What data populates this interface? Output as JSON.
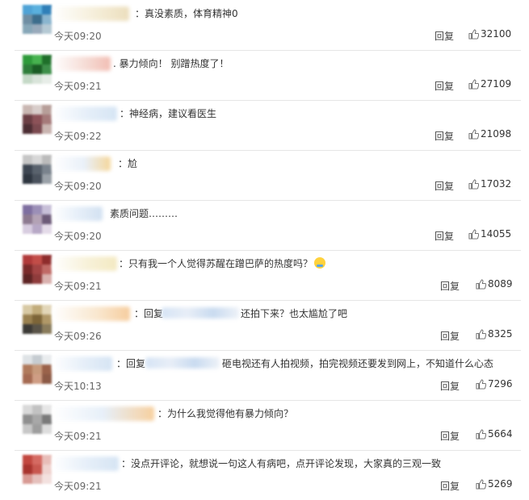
{
  "comments": [
    {
      "text": "：真没素质，体育精神0",
      "time": "今天09:20",
      "reply": "回复",
      "likes": "32100",
      "colors": [
        "#4fa3d6",
        "#5ab0de",
        "#2f7fb8",
        "#6f8ea3",
        "#3d6d8c",
        "#8ab5cf",
        "#87a7b8",
        "#9ab",
        "#b5c9d4"
      ],
      "nameColor": "#e9d9b2"
    },
    {
      "text": ". 暴力倾向！ 别蹭热度了！",
      "time": "今天09:21",
      "reply": "回复",
      "likes": "27109",
      "colors": [
        "#2e9a3a",
        "#47b24f",
        "#1f6f2a",
        "#2e7d3a",
        "#1a5c24",
        "#3e8f4a",
        "#c5d9c7",
        "#d9e4da",
        "#e7ede8"
      ],
      "nameColor": "#f0b3a7"
    },
    {
      "text": "：神经病，建议看医生",
      "time": "今天09:22",
      "reply": "回复",
      "likes": "21098",
      "colors": [
        "#c9b7b2",
        "#d8cdca",
        "#b79e99",
        "#6b3e44",
        "#8c5258",
        "#a57a7a",
        "#4c2d33",
        "#7b4a50",
        "#c9b4b0"
      ],
      "nameColor": "#cfe1f3"
    },
    {
      "text": "：尬",
      "time": "今天09:20",
      "reply": "回复",
      "likes": "17032",
      "colors": [
        "#c6c6c6",
        "#d7d7d7",
        "#bbbbbb",
        "#3d4652",
        "#59626d",
        "#7a838d",
        "#2e3640",
        "#4a525d",
        "#9aa1a8"
      ],
      "nameColor": "#f3d08a"
    },
    {
      "text": "素质问题………",
      "time": "今天09:20",
      "reply": "回复",
      "likes": "14055",
      "colors": [
        "#7e6fa0",
        "#9b8fb7",
        "#c7bfd8",
        "#8d7a90",
        "#b3a2b5",
        "#6c5a78",
        "#d8cde0",
        "#b7a8c6",
        "#e4dbe9"
      ],
      "nameColor": "#cbdcef"
    },
    {
      "text": "：只有我一个人觉得苏醒在蹭巴萨的热度吗？",
      "time": "今天09:21",
      "reply": "回复",
      "likes": "8089",
      "colors": [
        "#b03a3a",
        "#c24d48",
        "#8e2c2c",
        "#7a2a2a",
        "#a34444",
        "#c06a66",
        "#5e2424",
        "#8f3c3c",
        "#d9b1ae"
      ],
      "nameColor": "#f2e6b8"
    },
    {
      "text": "：回复",
      "text2": "还拍下来？也太尴尬了吧",
      "time": "今天09:26",
      "reply": "回复",
      "likes": "8325",
      "colors": [
        "#d8c9a4",
        "#c2ad7c",
        "#e2d6b8",
        "#9a8150",
        "#7d6538",
        "#b09868",
        "#3c3a36",
        "#5a5448",
        "#8a7c5c"
      ],
      "nameColor": "#f5c58e"
    },
    {
      "text": "：回复",
      "text2": "砸电视还有人拍视频，拍完视频还要发到网上，不知道什么心态",
      "time": "今天10:13",
      "reply": "回复",
      "likes": "7296",
      "colors": [
        "#dfe3e6",
        "#c6ccd1",
        "#e9ecee",
        "#b07a5c",
        "#c79a7c",
        "#9a624a",
        "#a56a52",
        "#cf9d84",
        "#8c5a46"
      ],
      "nameColor": "#cfe0f2"
    },
    {
      "text": "：为什么我觉得他有暴力倾向？",
      "time": "今天09:21",
      "reply": "回复",
      "likes": "5664",
      "colors": [
        "#d9d9d9",
        "#c2c2c2",
        "#e6e6e6",
        "#8f8f8f",
        "#a8a8a8",
        "#7a7a7a",
        "#c7c7c7",
        "#9e9e9e",
        "#dddddd"
      ],
      "nameColor": "#f6c88e"
    },
    {
      "text": "：没点开评论，就想说一句这人有病吧，点开评论发现，大家真的三观一致",
      "time": "今天09:21",
      "reply": "回复",
      "likes": "5269",
      "colors": [
        "#c2473f",
        "#d56a62",
        "#e8bdb8",
        "#a8342e",
        "#c8574f",
        "#efd3cf",
        "#d89a94",
        "#e5c0bc",
        "#f3e1df"
      ],
      "nameColor": "#cfe0f2"
    }
  ]
}
